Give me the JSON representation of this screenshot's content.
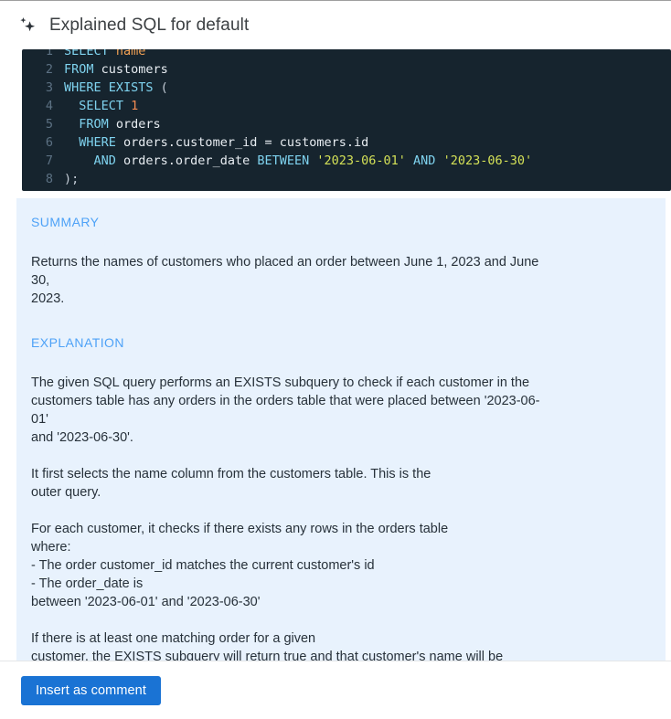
{
  "header": {
    "icon": "sparkle-icon",
    "title": "Explained SQL for default"
  },
  "code": {
    "language": "sql",
    "clipped_top": true,
    "clipped_bottom": true,
    "lines": [
      {
        "number": "1",
        "tokens": [
          {
            "t": "SELECT ",
            "c": "kw"
          },
          {
            "t": "name",
            "c": "col"
          }
        ]
      },
      {
        "number": "2",
        "tokens": [
          {
            "t": "FROM ",
            "c": "kw"
          },
          {
            "t": "customers",
            "c": "id"
          }
        ]
      },
      {
        "number": "3",
        "tokens": [
          {
            "t": "WHERE EXISTS ",
            "c": "kw"
          },
          {
            "t": "(",
            "c": "pun"
          }
        ]
      },
      {
        "number": "4",
        "tokens": [
          {
            "t": "  SELECT ",
            "c": "kw"
          },
          {
            "t": "1",
            "c": "num"
          }
        ]
      },
      {
        "number": "5",
        "tokens": [
          {
            "t": "  FROM ",
            "c": "kw"
          },
          {
            "t": "orders",
            "c": "id"
          }
        ]
      },
      {
        "number": "6",
        "tokens": [
          {
            "t": "  WHERE ",
            "c": "kw"
          },
          {
            "t": "orders.customer_id = customers.id",
            "c": "id"
          }
        ]
      },
      {
        "number": "7",
        "tokens": [
          {
            "t": "    AND ",
            "c": "kw"
          },
          {
            "t": "orders.order_date ",
            "c": "id"
          },
          {
            "t": "BETWEEN ",
            "c": "kw"
          },
          {
            "t": "'2023-06-01'",
            "c": "str"
          },
          {
            "t": " AND ",
            "c": "kw"
          },
          {
            "t": "'2023-06-30'",
            "c": "str"
          }
        ]
      },
      {
        "number": "8",
        "tokens": [
          {
            "t": ");",
            "c": "pun"
          }
        ]
      }
    ]
  },
  "explanation": {
    "summary_label": "SUMMARY",
    "summary_text": "Returns the names of customers who placed an order between June 1, 2023 and June 30,\n2023.",
    "explanation_label": "EXPLANATION",
    "paragraphs": [
      "The given SQL query performs an EXISTS subquery to check if each customer in the\ncustomers table has any orders in the orders table that were placed between '2023-06-01'\nand '2023-06-30'.",
      "It first selects the name column from the customers table. This is the\nouter query.",
      "For each customer, it checks if there exists any rows in the orders table\nwhere:\n- The order customer_id matches the current customer's id\n- The order_date is\nbetween '2023-06-01' and '2023-06-30'",
      "If there is at least one matching order for a given\ncustomer, the EXISTS subquery will return true and that customer's name will be included\nin the result set."
    ]
  },
  "footer": {
    "insert_button_label": "Insert as comment"
  },
  "colors": {
    "accent_blue": "#1a73d4",
    "panel_background": "#e8f2fd",
    "section_heading": "#4ea2f7",
    "code_background": "#16242e",
    "code_keyword": "#7fd3ef",
    "code_string": "#d4e157",
    "code_number": "#f28b52",
    "code_column": "#f0a054",
    "code_line_number": "#5c7183"
  }
}
